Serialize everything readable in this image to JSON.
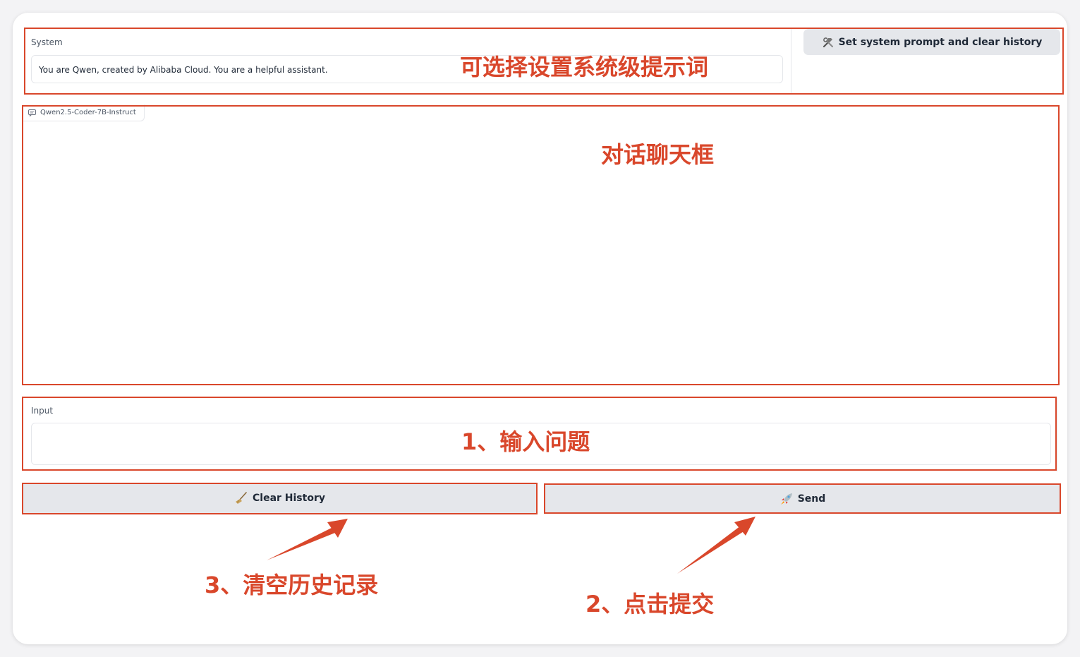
{
  "system": {
    "label": "System",
    "value": "You are Qwen, created by Alibaba Cloud. You are a helpful assistant.",
    "set_button_icon": "hammer-and-wrench-icon",
    "set_button_label": "Set system prompt and clear history"
  },
  "chatbot": {
    "tag_icon": "chat-bubble-icon",
    "model_name": "Qwen2.5-Coder-7B-Instruct"
  },
  "input": {
    "label": "Input",
    "value": ""
  },
  "buttons": {
    "clear_icon": "broom-icon",
    "clear_label": "Clear History",
    "send_icon": "rocket-icon",
    "send_label": "Send"
  },
  "annotations": {
    "system_note": "可选择设置系统级提示词",
    "chat_note": "对话聊天框",
    "input_note": "1、输入问题",
    "clear_note": "3、清空历史记录",
    "send_note": "2、点击提交"
  },
  "colors": {
    "annotation": "#d9472b",
    "button_bg": "#e5e7eb"
  }
}
